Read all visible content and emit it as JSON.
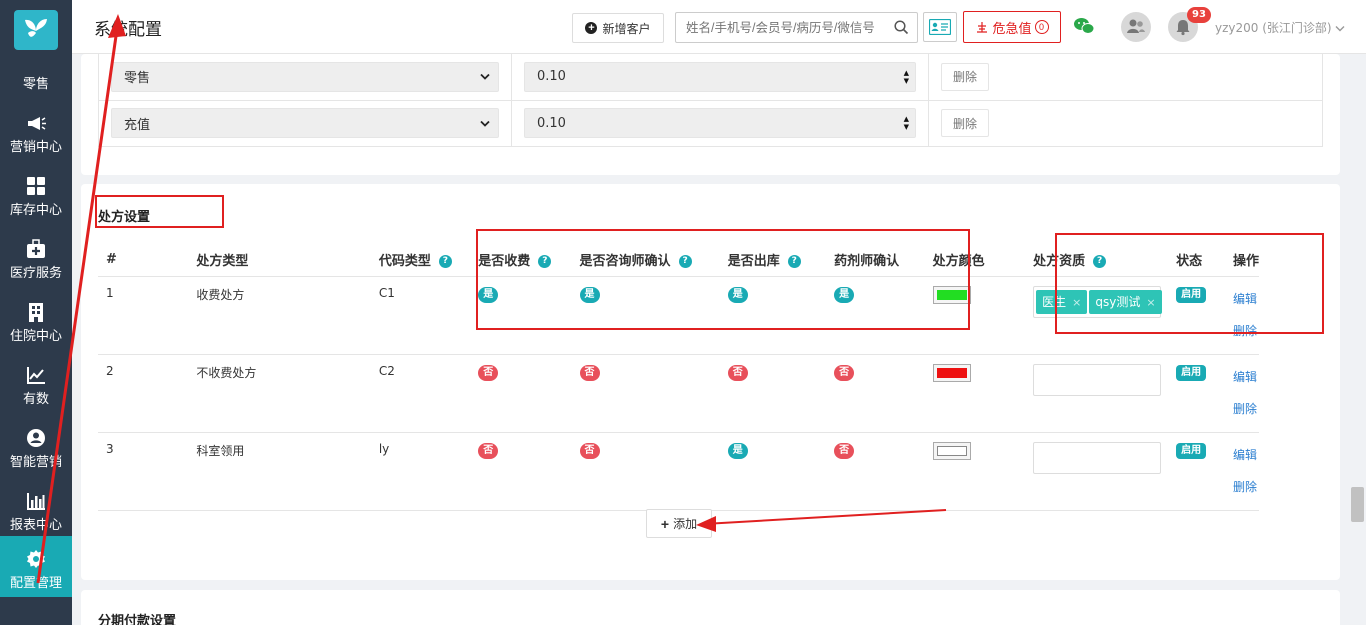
{
  "sidebar": {
    "items": [
      {
        "label": "零售"
      },
      {
        "label": "营销中心"
      },
      {
        "label": "库存中心"
      },
      {
        "label": "医疗服务"
      },
      {
        "label": "住院中心"
      },
      {
        "label": "有数"
      },
      {
        "label": "智能营销"
      },
      {
        "label": "报表中心"
      },
      {
        "label": "配置管理"
      }
    ],
    "active_index": 8
  },
  "header": {
    "title": "系统配置",
    "new_customer_label": "新增客户",
    "search_placeholder": "姓名/手机号/会员号/病历号/微信号",
    "danger_label": "危急值",
    "danger_count": "0",
    "notification_count": "93",
    "user_label": "yzy200 (张江门诊部)"
  },
  "rate_rows": [
    {
      "type": "零售",
      "value": "0.10",
      "delete_label": "删除"
    },
    {
      "type": "充值",
      "value": "0.10",
      "delete_label": "删除"
    }
  ],
  "prescription": {
    "section_title": "处方设置",
    "columns": {
      "index": "#",
      "type": "处方类型",
      "code": "代码类型",
      "charge": "是否收费",
      "consultant": "是否咨询师确认",
      "outbound": "是否出库",
      "pharmacist": "药剂师确认",
      "color": "处方颜色",
      "qualification": "处方资质",
      "status": "状态",
      "ops": "操作"
    },
    "rows": [
      {
        "index": "1",
        "type": "收费处方",
        "code": "C1",
        "charge": "是",
        "consultant": "是",
        "outbound": "是",
        "pharmacist": "是",
        "color": "#22dd22",
        "tags": [
          "医生",
          "qsy测试"
        ],
        "status": "启用",
        "edit": "编辑",
        "delete": "删除"
      },
      {
        "index": "2",
        "type": "不收费处方",
        "code": "C2",
        "charge": "否",
        "consultant": "否",
        "outbound": "否",
        "pharmacist": "否",
        "color": "#ee1111",
        "tags": [],
        "status": "启用",
        "edit": "编辑",
        "delete": "删除"
      },
      {
        "index": "3",
        "type": "科室领用",
        "code": "ly",
        "charge": "否",
        "consultant": "否",
        "outbound": "是",
        "pharmacist": "否",
        "color": "#ffffff",
        "tags": [],
        "status": "启用",
        "edit": "编辑",
        "delete": "删除"
      }
    ],
    "add_label": "添加"
  },
  "installment": {
    "section_title": "分期付款设置"
  },
  "colors": {
    "sidebar_bg": "#2d3a4b",
    "accent": "#19aab4",
    "no_pill": "#e8505b",
    "annotation": "#e02020",
    "link": "#2a7ed0"
  }
}
